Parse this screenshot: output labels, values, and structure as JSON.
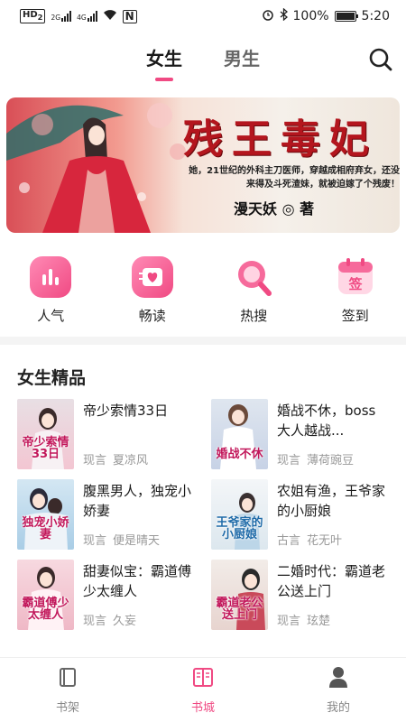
{
  "status_bar": {
    "hd": "HD",
    "hd_sim": "2",
    "net1": "2G",
    "net2": "4G",
    "battery_pct": "100%",
    "time": "5:20",
    "battery_level": 1.0
  },
  "top_tabs": [
    {
      "label": "女生",
      "active": true
    },
    {
      "label": "男生",
      "active": false
    }
  ],
  "banner": {
    "title": "残王毒妃",
    "description": "她，21世纪的外科主刀医师，穿越成相府弃女，还没来得及斗死渣妹，就被迫嫁了个残废！",
    "author": "漫天妖 ◎ 著"
  },
  "categories": [
    {
      "label": "人气",
      "icon": "bar-chart-icon"
    },
    {
      "label": "畅读",
      "icon": "heart-book-icon"
    },
    {
      "label": "热搜",
      "icon": "magnifier-icon"
    },
    {
      "label": "签到",
      "icon": "calendar-sign-icon"
    }
  ],
  "section": {
    "title": "女生精品",
    "books": [
      {
        "title": "帝少索情33日",
        "genre": "现言",
        "author": "夏凉风",
        "cover_text": "帝少索情33日"
      },
      {
        "title": "婚战不休，boss大人越战...",
        "genre": "现言",
        "author": "薄荷豌豆",
        "cover_text": "婚战不休"
      },
      {
        "title": "腹黑男人，独宠小娇妻",
        "genre": "现言",
        "author": "便是晴天",
        "cover_text": "独宠小娇妻"
      },
      {
        "title": "农姐有渔，王爷家的小厨娘",
        "genre": "古言",
        "author": "花无叶",
        "cover_text": "王爷家的小厨娘"
      },
      {
        "title": "甜妻似宝：霸道傅少太缠人",
        "genre": "现言",
        "author": "久妄",
        "cover_text": "霸道傅少太缠人"
      },
      {
        "title": "二婚时代：霸道老公送上门",
        "genre": "现言",
        "author": "玹楚",
        "cover_text": "霸道老公送上门"
      }
    ]
  },
  "bottom_nav": [
    {
      "label": "书架",
      "icon": "bookshelf-icon",
      "active": false
    },
    {
      "label": "书城",
      "icon": "bookstore-icon",
      "active": true
    },
    {
      "label": "我的",
      "icon": "profile-icon",
      "active": false
    }
  ],
  "colors": {
    "accent": "#f04a83",
    "banner_title": "#b4161e"
  }
}
